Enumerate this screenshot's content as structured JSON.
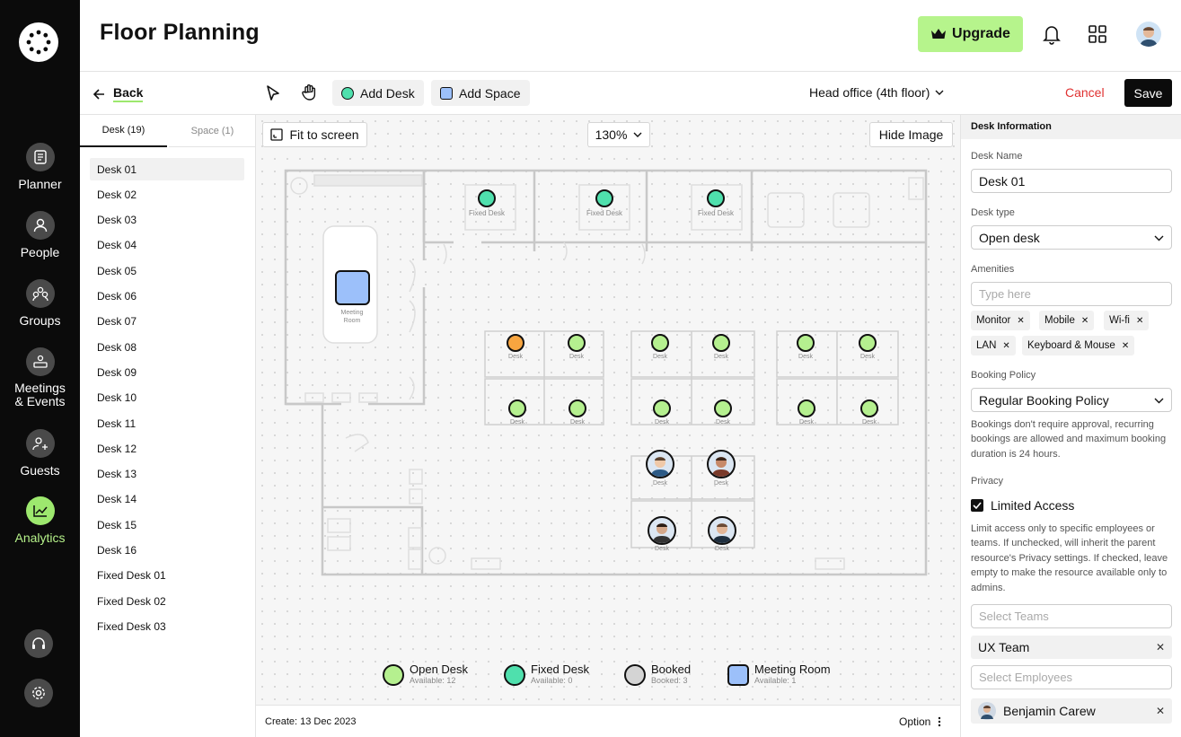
{
  "nav": {
    "items": [
      {
        "label": "Planner",
        "icon": "planner-icon"
      },
      {
        "label": "People",
        "icon": "person-icon"
      },
      {
        "label": "Groups",
        "icon": "groups-icon"
      },
      {
        "label": "Meetings\n& Events",
        "icon": "meetings-icon"
      },
      {
        "label": "Guests",
        "icon": "guests-icon"
      },
      {
        "label": "Analytics",
        "icon": "analytics-icon",
        "active": true
      }
    ],
    "accent": "#9de86e"
  },
  "header": {
    "title": "Floor Planning",
    "upgrade_label": "Upgrade",
    "upgrade_color": "#b6f48c"
  },
  "toolbar": {
    "back_label": "Back",
    "add_desk_label": "Add Desk",
    "add_space_label": "Add Space",
    "floor_select": "Head office (4th floor)",
    "cancel_label": "Cancel",
    "save_label": "Save"
  },
  "left_panel": {
    "tab_desk": "Desk (19)",
    "tab_space": "Space (1)",
    "items": [
      "Desk 01",
      "Desk 02",
      "Desk 03",
      "Desk 04",
      "Desk 05",
      "Desk 06",
      "Desk 07",
      "Desk 08",
      "Desk 09",
      "Desk 10",
      "Desk 11",
      "Desk 12",
      "Desk 13",
      "Desk 14",
      "Desk 15",
      "Desk 16",
      "Fixed Desk 01",
      "Fixed Desk 02",
      "Fixed Desk 03"
    ],
    "selected_index": 0
  },
  "canvas": {
    "fit_label": "Fit to screen",
    "zoom": "130%",
    "hide_image_label": "Hide Image",
    "fixed_desk_label": "Fixed Desk",
    "desk_label": "Desk",
    "meeting_room_label": "Meeting\nRoom",
    "legend": [
      {
        "name": "Open Desk",
        "sub": "Available: 12",
        "color": "#b5f08f"
      },
      {
        "name": "Fixed Desk",
        "sub": "Available: 0",
        "color": "#4fe0ad"
      },
      {
        "name": "Booked",
        "sub": "Booked: 3",
        "color": "#d4d4d4"
      },
      {
        "name": "Meeting Room",
        "sub": "Available: 1",
        "color": "#9cc0fa"
      }
    ],
    "orange_color": "#f7a540"
  },
  "footer": {
    "created": "Create: 13 Dec 2023",
    "option_label": "Option"
  },
  "right_panel": {
    "section_title": "Desk Information",
    "desk_name_label": "Desk Name",
    "desk_name_value": "Desk 01",
    "desk_type_label": "Desk type",
    "desk_type_value": "Open desk",
    "amenities_label": "Amenities",
    "amenities_placeholder": "Type here",
    "amenities": [
      "Monitor",
      "Mobile",
      "Wi-fi",
      "LAN",
      "Keyboard & Mouse"
    ],
    "booking_policy_label": "Booking Policy",
    "booking_policy_value": "Regular Booking Policy",
    "booking_policy_help": "Bookings don't require approval, recurring bookings are allowed and maximum booking duration is 24 hours.",
    "privacy_label": "Privacy",
    "limited_access_label": "Limited Access",
    "limited_access_checked": true,
    "privacy_help": "Limit access only to specific employees or teams. If unchecked, will inherit the parent resource's Privacy settings. If checked, leave empty to make the resource available only to admins.",
    "teams_placeholder": "Select Teams",
    "team_selected": "UX Team",
    "employees_placeholder": "Select Employees",
    "employee_selected": "Benjamin Carew"
  }
}
